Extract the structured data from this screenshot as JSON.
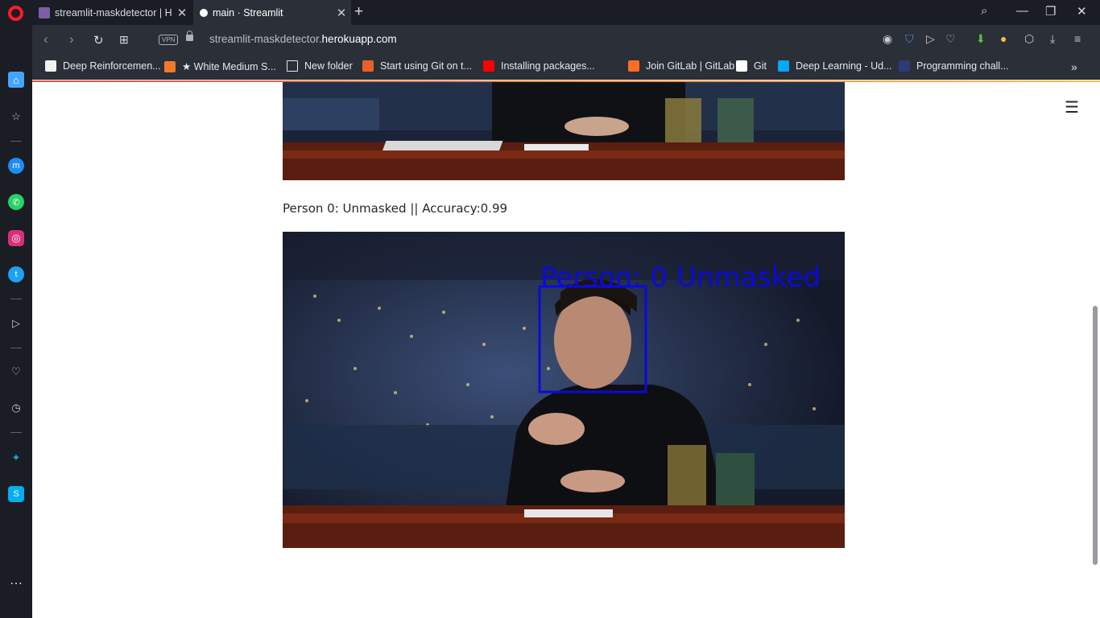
{
  "browser": {
    "tabs": [
      {
        "title": "streamlit-maskdetector | Heroku"
      },
      {
        "title": "main · Streamlit"
      }
    ],
    "url_prefix": "streamlit-maskdetector.",
    "url_domain": "herokuapp.com",
    "vpn_label": "VPN",
    "bookmarks": [
      {
        "label": "Deep Reinforcemen..."
      },
      {
        "label": "★ White Medium S..."
      },
      {
        "label": "New folder"
      },
      {
        "label": "Start using Git on t..."
      },
      {
        "label": "Installing packages..."
      },
      {
        "label": "Join GitLab | GitLab"
      },
      {
        "label": "Git"
      },
      {
        "label": "Deep Learning - Ud..."
      },
      {
        "label": "Programming chall..."
      }
    ]
  },
  "app": {
    "result_caption": "Person 0: Unmasked || Accuracy:0.99",
    "detection_label": "Person: 0 Unmasked",
    "colors": {
      "box": "#0a0adc",
      "accent": "#ff4b4b"
    }
  }
}
